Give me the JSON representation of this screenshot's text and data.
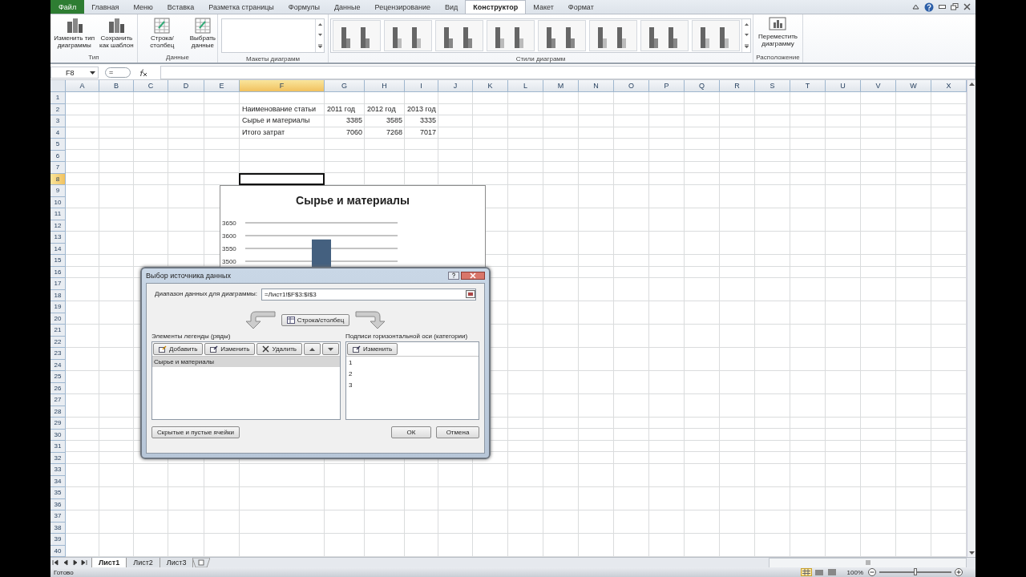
{
  "ribbon_tabs": [
    {
      "label": "Файл",
      "kind": "file",
      "selected": false
    },
    {
      "label": "Главная",
      "kind": "tab",
      "selected": false
    },
    {
      "label": "Меню",
      "kind": "tab",
      "selected": false
    },
    {
      "label": "Вставка",
      "kind": "tab",
      "selected": false
    },
    {
      "label": "Разметка страницы",
      "kind": "tab",
      "selected": false
    },
    {
      "label": "Формулы",
      "kind": "tab",
      "selected": false
    },
    {
      "label": "Данные",
      "kind": "tab",
      "selected": false
    },
    {
      "label": "Рецензирование",
      "kind": "tab",
      "selected": false
    },
    {
      "label": "Вид",
      "kind": "tab",
      "selected": false
    },
    {
      "label": "Конструктор",
      "kind": "tab",
      "selected": true
    },
    {
      "label": "Макет",
      "kind": "tab",
      "selected": false
    },
    {
      "label": "Формат",
      "kind": "tab",
      "selected": false
    }
  ],
  "ribbon_groups": [
    {
      "label": "Тип",
      "kind": "buttons",
      "buttons": [
        "Изменить тип\nдиаграммы",
        "Сохранить\nкак шаблон"
      ]
    },
    {
      "label": "Данные",
      "kind": "buttons",
      "buttons": [
        "Строка/столбец",
        "Выбрать\nданные"
      ]
    },
    {
      "label": "Макеты диаграмм",
      "kind": "layouts"
    },
    {
      "label": "Стили диаграмм",
      "kind": "styles"
    },
    {
      "label": "Расположение",
      "kind": "buttons",
      "buttons": [
        "Переместить\nдиаграмму"
      ]
    }
  ],
  "formula_bar": {
    "name_box": "F8",
    "formula": "="
  },
  "columns": [
    {
      "label": "A",
      "selected": false
    },
    {
      "label": "B",
      "selected": false
    },
    {
      "label": "C",
      "selected": false
    },
    {
      "label": "D",
      "selected": false
    },
    {
      "label": "E",
      "selected": false
    },
    {
      "label": "F",
      "selected": true
    },
    {
      "label": "G",
      "selected": false
    },
    {
      "label": "H",
      "selected": false
    },
    {
      "label": "I",
      "selected": false
    },
    {
      "label": "J",
      "selected": false
    },
    {
      "label": "K",
      "selected": false
    },
    {
      "label": "L",
      "selected": false
    },
    {
      "label": "M",
      "selected": false
    },
    {
      "label": "N",
      "selected": false
    },
    {
      "label": "O",
      "selected": false
    },
    {
      "label": "P",
      "selected": false
    },
    {
      "label": "Q",
      "selected": false
    },
    {
      "label": "R",
      "selected": false
    },
    {
      "label": "S",
      "selected": false
    },
    {
      "label": "T",
      "selected": false
    },
    {
      "label": "U",
      "selected": false
    },
    {
      "label": "V",
      "selected": false
    },
    {
      "label": "W",
      "selected": false
    },
    {
      "label": "X",
      "selected": false
    }
  ],
  "rows": [
    {
      "label": "1",
      "selected": false
    },
    {
      "label": "2",
      "selected": false
    },
    {
      "label": "3",
      "selected": false
    },
    {
      "label": "4",
      "selected": false
    },
    {
      "label": "5",
      "selected": false
    },
    {
      "label": "6",
      "selected": false
    },
    {
      "label": "7",
      "selected": false
    },
    {
      "label": "8",
      "selected": true
    },
    {
      "label": "9",
      "selected": false
    },
    {
      "label": "10",
      "selected": false
    },
    {
      "label": "11",
      "selected": false
    },
    {
      "label": "12",
      "selected": false
    },
    {
      "label": "13",
      "selected": false
    },
    {
      "label": "14",
      "selected": false
    },
    {
      "label": "15",
      "selected": false
    },
    {
      "label": "16",
      "selected": false
    },
    {
      "label": "17",
      "selected": false
    },
    {
      "label": "18",
      "selected": false
    },
    {
      "label": "19",
      "selected": false
    },
    {
      "label": "20",
      "selected": false
    },
    {
      "label": "21",
      "selected": false
    },
    {
      "label": "22",
      "selected": false
    },
    {
      "label": "23",
      "selected": false
    },
    {
      "label": "24",
      "selected": false
    },
    {
      "label": "25",
      "selected": false
    },
    {
      "label": "26",
      "selected": false
    },
    {
      "label": "27",
      "selected": false
    },
    {
      "label": "28",
      "selected": false
    },
    {
      "label": "29",
      "selected": false
    },
    {
      "label": "30",
      "selected": false
    },
    {
      "label": "31",
      "selected": false
    },
    {
      "label": "32",
      "selected": false
    },
    {
      "label": "33",
      "selected": false
    },
    {
      "label": "34",
      "selected": false
    },
    {
      "label": "35",
      "selected": false
    },
    {
      "label": "36",
      "selected": false
    },
    {
      "label": "37",
      "selected": false
    },
    {
      "label": "38",
      "selected": false
    },
    {
      "label": "39",
      "selected": false
    },
    {
      "label": "40",
      "selected": false
    }
  ],
  "table": [
    [
      "Наименование статьи",
      "2011 год",
      "2012 год",
      "2013 год"
    ],
    [
      "Сырье и материалы",
      "3385",
      "3585",
      "3335"
    ],
    [
      "Итого затрат",
      "7060",
      "7268",
      "7017"
    ]
  ],
  "chart": {
    "chart_data": {
      "type": "bar",
      "title": "Сырье и материалы",
      "ylim": [
        3450,
        3650
      ],
      "grid": true,
      "yticks": [
        3500,
        3550,
        3600,
        3650
      ],
      "values": [
        null,
        3585,
        null
      ]
    }
  },
  "dialog": {
    "title": "Выбор источника данных",
    "range_label": "Диапазон данных для диаграммы:",
    "range_value": "=Лист1!$F$3:$I$3",
    "switch_button": "Строка/столбец",
    "legend": {
      "label": "Элементы легенды (ряды)",
      "buttons": [
        "Добавить",
        "Изменить",
        "Удалить"
      ],
      "items": [
        {
          "label": "Сырье и материалы",
          "selected": true
        }
      ]
    },
    "axis": {
      "label": "Подписи горизонтальной оси (категории)",
      "button": "Изменить",
      "items": [
        "1",
        "2",
        "3"
      ]
    },
    "hidden_cells_button": "Скрытые и пустые ячейки",
    "ok_button": "ОК",
    "cancel_button": "Отмена"
  },
  "sheet_tabs": [
    {
      "label": "Лист1",
      "selected": true
    },
    {
      "label": "Лист2",
      "selected": false
    },
    {
      "label": "Лист3",
      "selected": false
    }
  ],
  "status_bar": {
    "status": "Готово",
    "zoom": "100%",
    "zoom_slider": {
      "level": 0.5
    }
  }
}
